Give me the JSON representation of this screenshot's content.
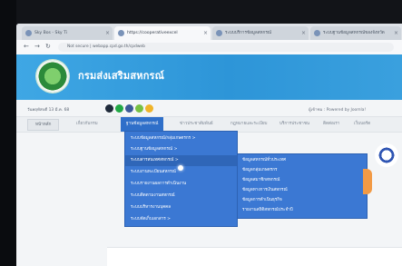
{
  "browser": {
    "tabs": [
      {
        "label": "Sky Bos - Sky Ti"
      },
      {
        "label": "https://cooperativeexcel"
      },
      {
        "label": "ระบบบริการข้อมูลสหกรณ์"
      },
      {
        "label": "ระบบฐานข้อมูลสหกรณ์ของจังหวัด"
      }
    ],
    "address": "Not secure | webapp.cpd.go.th/cpdweb"
  },
  "banner": {
    "title": "กรมส่งเสริมสหกรณ์"
  },
  "info": {
    "date": "วันพฤหัสบดี 13 มี.ค. 68",
    "right_text": "ผู้เข้าชม : Powered by Joomla!"
  },
  "menu": {
    "items": [
      {
        "label": "หน้าหลัก"
      },
      {
        "label": "เกี่ยวกับกรม"
      },
      {
        "label": "ฐานข้อมูลสหกรณ์"
      },
      {
        "label": "ข่าวประชาสัมพันธ์"
      },
      {
        "label": "กฎหมายและระเบียบ"
      },
      {
        "label": "บริการประชาชน"
      },
      {
        "label": "ติดต่อเรา"
      },
      {
        "label": "เว็บบอร์ด"
      }
    ]
  },
  "dropdown": {
    "items": [
      {
        "label": "ระบบข้อมูลสหกรณ์/กลุ่มเกษตรกร >"
      },
      {
        "label": "ระบบฐานข้อมูลสหกรณ์ >"
      },
      {
        "label": "ระบบสารสนเทศสหกรณ์ >"
      },
      {
        "label": "ระบบงานทะเบียนสหกรณ์"
      },
      {
        "label": "ระบบรายงานผลการดำเนินงาน"
      },
      {
        "label": "ระบบติดตามงานสหกรณ์"
      },
      {
        "label": "ระบบบริหารงานบุคคล"
      },
      {
        "label": "ระบบจัดเก็บเอกสาร >"
      }
    ]
  },
  "submenu": {
    "items": [
      {
        "label": "ข้อมูลสหกรณ์ทั่วประเทศ"
      },
      {
        "label": "ข้อมูลกลุ่มเกษตรกร"
      },
      {
        "label": "ข้อมูลสมาชิกสหกรณ์"
      },
      {
        "label": "ข้อมูลทางการเงินสหกรณ์"
      },
      {
        "label": "ข้อมูลการดำเนินธุรกิจ"
      },
      {
        "label": "รายงานสถิติสหกรณ์ประจำปี"
      }
    ]
  },
  "colors": {
    "banner": "#2d95d8",
    "menu_active": "#2f6fc9",
    "dropdown": "#3b78d3"
  }
}
